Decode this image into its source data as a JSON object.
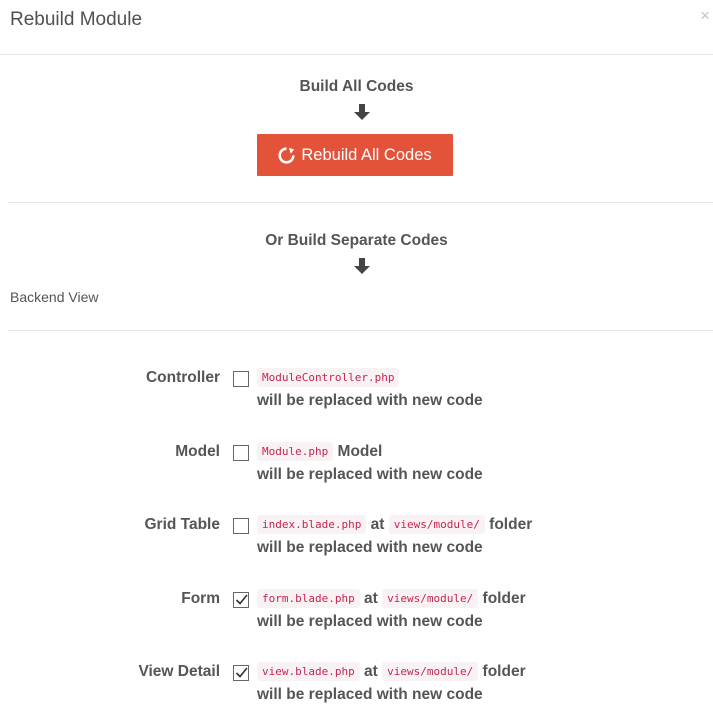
{
  "modal": {
    "title": "Rebuild Module",
    "close_label": "×"
  },
  "build_all": {
    "heading": "Build All Codes",
    "button_label": "Rebuild All Codes"
  },
  "separate": {
    "heading": "Or Build Separate Codes",
    "backend_label": "Backend View"
  },
  "rows": [
    {
      "label": "Controller",
      "checked": false,
      "file": "ModuleController.php",
      "suffix": "",
      "folder": "",
      "folder_suffix": "",
      "note": "will be replaced with new code"
    },
    {
      "label": "Model",
      "checked": false,
      "file": "Module.php",
      "suffix": "Model",
      "folder": "",
      "folder_suffix": "",
      "note": "will be replaced with new code"
    },
    {
      "label": "Grid Table",
      "checked": false,
      "file": "index.blade.php",
      "suffix": "at",
      "folder": "views/module/",
      "folder_suffix": "folder",
      "note": "will be replaced with new code"
    },
    {
      "label": "Form",
      "checked": true,
      "file": "form.blade.php",
      "suffix": "at",
      "folder": "views/module/",
      "folder_suffix": "folder",
      "note": "will be replaced with new code"
    },
    {
      "label": "View Detail",
      "checked": true,
      "file": "view.blade.php",
      "suffix": "at",
      "folder": "views/module/",
      "folder_suffix": "folder",
      "note": "will be replaced with new code"
    }
  ],
  "colors": {
    "button_bg": "#e2533a",
    "code_text": "#c7254e",
    "code_bg": "#f9f2f4"
  },
  "icons": {
    "close": "close-icon",
    "arrow": "arrow-down-icon",
    "refresh": "refresh-icon",
    "check": "check-icon"
  }
}
